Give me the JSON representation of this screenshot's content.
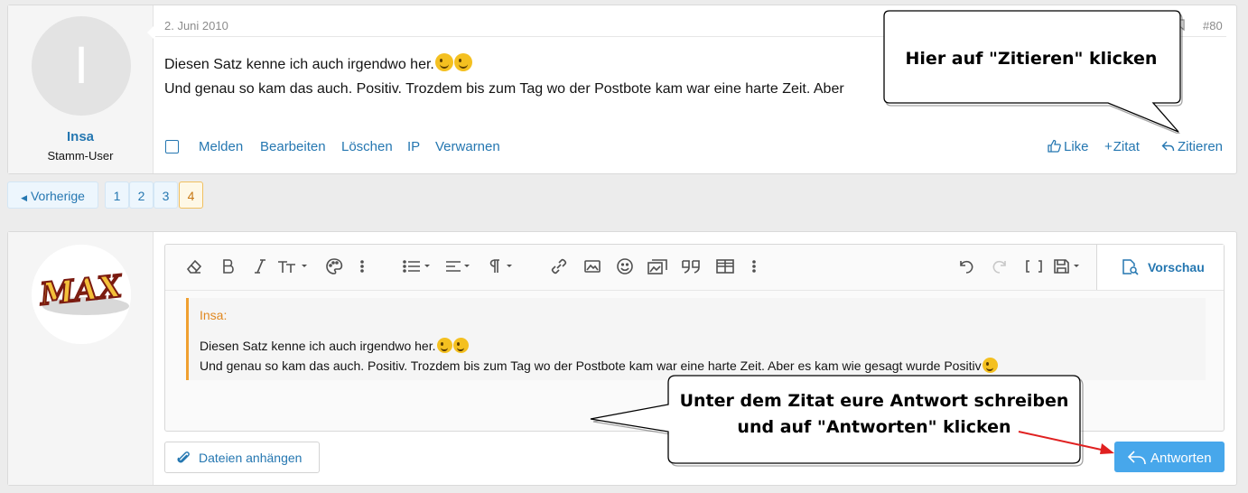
{
  "post": {
    "username": "Insa",
    "user_role": "Stamm-User",
    "avatar_letter": "I",
    "date": "2. Juni 2010",
    "number": "#80",
    "line1": "Diesen Satz kenne ich auch irgendwo her.",
    "line2": "Und genau so kam das auch. Positiv. Trozdem bis zum Tag wo der Postbote kam war eine harte Zeit. Aber",
    "actions": {
      "report": "Melden",
      "edit": "Bearbeiten",
      "delete": "Löschen",
      "ip": "IP",
      "warn": "Verwarnen",
      "like": "Like",
      "quote": "Zitat",
      "reply_quote": "Zitieren"
    }
  },
  "pagination": {
    "prev": "Vorherige",
    "pages": [
      "1",
      "2",
      "3",
      "4"
    ],
    "current": "4"
  },
  "editor": {
    "preview": "Vorschau",
    "quote_author": "Insa:",
    "quote_line1": "Diesen Satz kenne ich auch irgendwo her.",
    "quote_line2": "Und genau so kam das auch. Positiv. Trozdem bis zum Tag wo der Postbote kam war eine harte Zeit. Aber es kam wie gesagt wurde Positiv",
    "attach": "Dateien anhängen",
    "submit": "Antworten"
  },
  "reply_avatar_logo_text": "MAX",
  "callouts": {
    "top": "Hier auf \"Zitieren\" klicken",
    "bottom_line1": "Unter dem Zitat eure Antwort schreiben",
    "bottom_line2": "und auf \"Antworten\" klicken"
  },
  "colors": {
    "link": "#2577b1",
    "accent_button": "#47a7eb",
    "quote_border": "#f0a030",
    "callout_arrow": "#e02020"
  }
}
